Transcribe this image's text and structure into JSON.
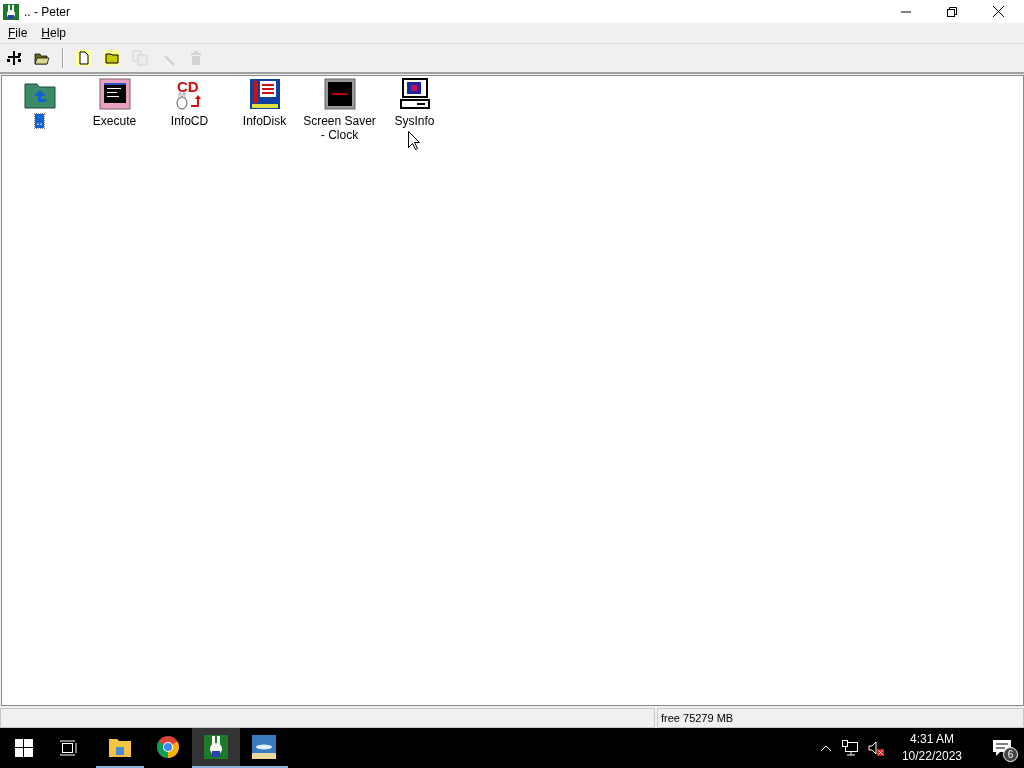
{
  "window": {
    "title": ".. - Peter"
  },
  "menu": [
    {
      "label": "File"
    },
    {
      "label": "Help"
    }
  ],
  "toolbar": [
    {
      "kind": "tree",
      "disabled": false
    },
    {
      "kind": "open",
      "disabled": false
    },
    {
      "kind": "sep"
    },
    {
      "kind": "newfile",
      "disabled": false
    },
    {
      "kind": "newfolder",
      "disabled": false
    },
    {
      "kind": "copy",
      "disabled": true
    },
    {
      "kind": "text",
      "disabled": true
    },
    {
      "kind": "delete",
      "disabled": true
    }
  ],
  "files": [
    {
      "label": "..",
      "kind": "up",
      "selected": true
    },
    {
      "label": "Execute",
      "kind": "terminal",
      "selected": false
    },
    {
      "label": "InfoCD",
      "kind": "cd",
      "icon_text": "CD",
      "selected": false
    },
    {
      "label": "InfoDisk",
      "kind": "disk",
      "selected": false
    },
    {
      "label": "Screen Saver - Clock",
      "kind": "clock",
      "selected": false
    },
    {
      "label": "SysInfo",
      "kind": "computer",
      "selected": false
    }
  ],
  "status_bar": {
    "free_space": "free 75279 MB"
  },
  "taskbar": {
    "apps": [
      {
        "kind": "folder",
        "running": true,
        "active": false
      },
      {
        "kind": "chrome",
        "running": false,
        "active": false
      },
      {
        "kind": "rabbit",
        "running": true,
        "active": true
      },
      {
        "kind": "fish",
        "running": true,
        "active": false
      }
    ],
    "time": "4:31 AM",
    "date": "10/22/2023",
    "notifications": "6"
  }
}
